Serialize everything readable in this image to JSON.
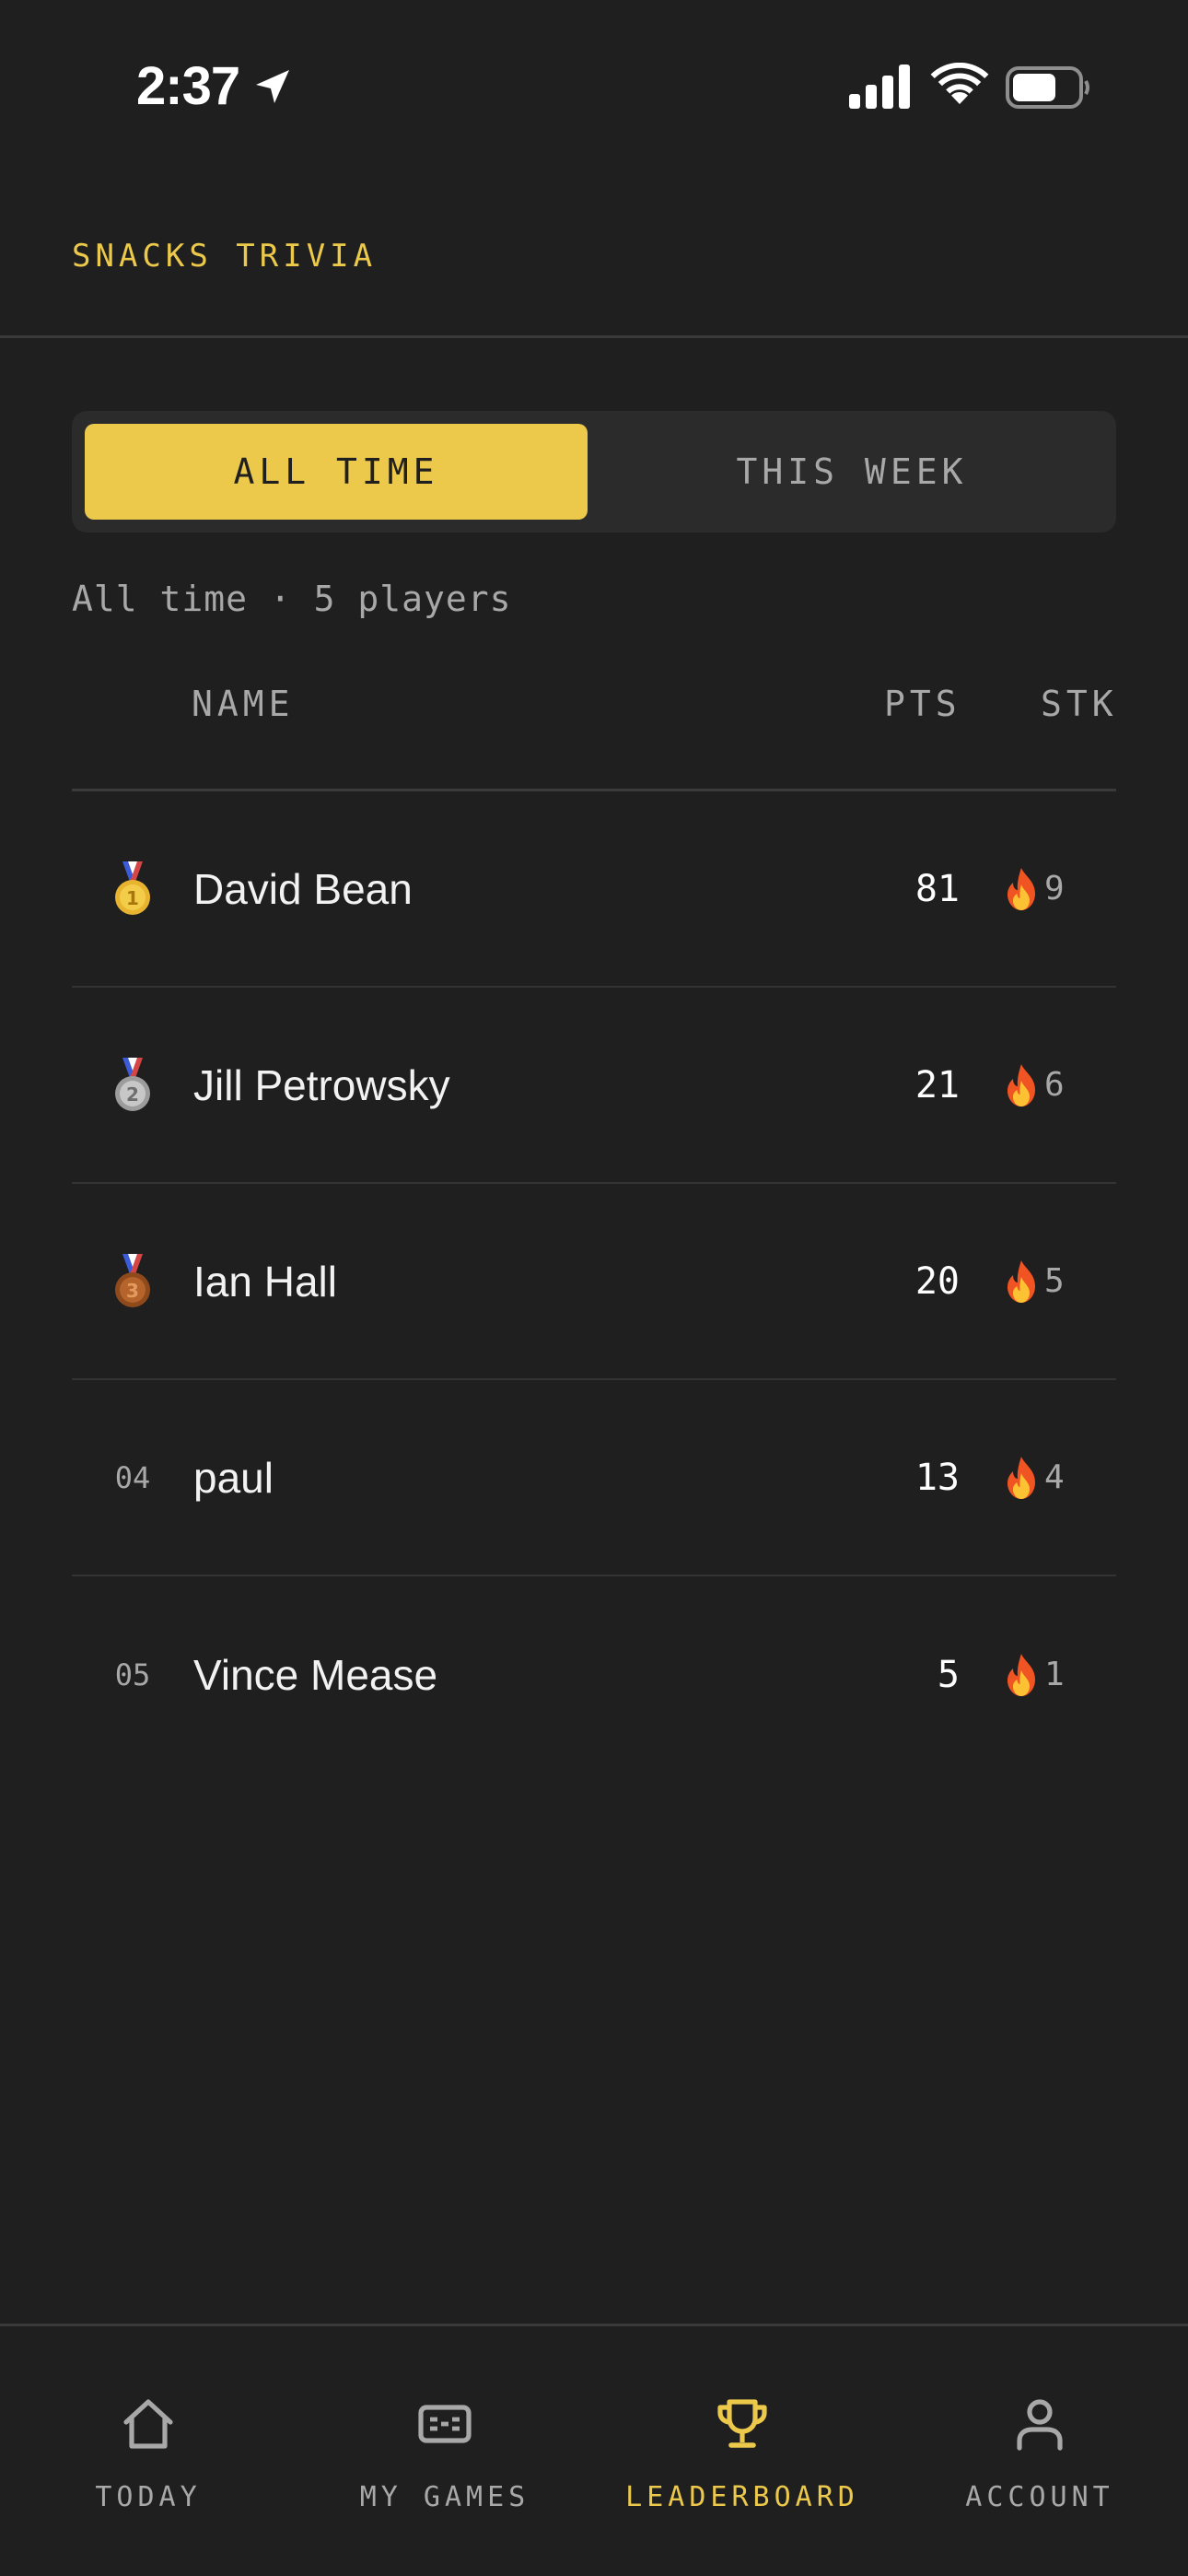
{
  "status_bar": {
    "time": "2:37"
  },
  "header": {
    "title": "SNACKS TRIVIA"
  },
  "tabs": [
    {
      "label": "ALL TIME",
      "active": true
    },
    {
      "label": "THIS WEEK",
      "active": false
    }
  ],
  "subtitle": "All time · 5 players",
  "table": {
    "headers": {
      "name": "NAME",
      "pts": "PTS",
      "stk": "STK"
    },
    "rows": [
      {
        "rank": "1",
        "rank_display": "gold-medal-icon",
        "name": "David Bean",
        "pts": "81",
        "streak": "9"
      },
      {
        "rank": "2",
        "rank_display": "silver-medal-icon",
        "name": "Jill Petrowsky",
        "pts": "21",
        "streak": "6"
      },
      {
        "rank": "3",
        "rank_display": "bronze-medal-icon",
        "name": "Ian Hall",
        "pts": "20",
        "streak": "5"
      },
      {
        "rank": "04",
        "rank_display": "text",
        "name": "paul",
        "pts": "13",
        "streak": "4"
      },
      {
        "rank": "05",
        "rank_display": "text",
        "name": "Vince Mease",
        "pts": "5",
        "streak": "1"
      }
    ]
  },
  "nav": [
    {
      "label": "TODAY",
      "icon": "home-icon",
      "active": false
    },
    {
      "label": "MY GAMES",
      "icon": "ticket-icon",
      "active": false
    },
    {
      "label": "LEADERBOARD",
      "icon": "trophy-icon",
      "active": true
    },
    {
      "label": "ACCOUNT",
      "icon": "person-icon",
      "active": false
    }
  ],
  "colors": {
    "accent": "#ecc94b",
    "background": "#1f1f1f",
    "muted": "#a8a8a8"
  }
}
